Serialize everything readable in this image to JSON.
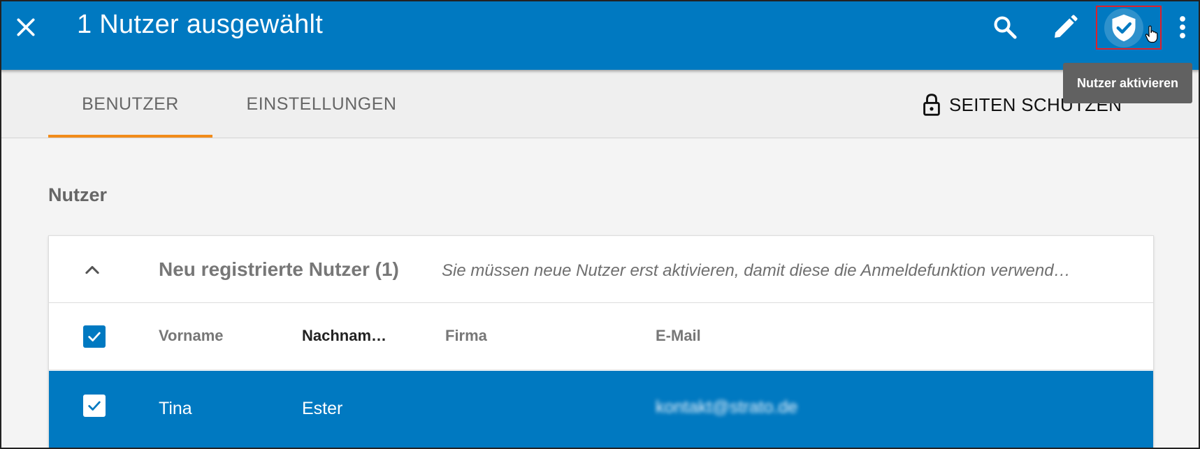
{
  "appbar": {
    "title": "1 Nutzer ausgewählt",
    "icons": {
      "close": "close-icon",
      "search": "search-icon",
      "edit": "pencil-icon",
      "activate": "shield-check-icon",
      "more": "more-vert-icon"
    },
    "colors": {
      "background": "#0079c1",
      "highlight_box": "#e0202a"
    }
  },
  "tooltip": {
    "text": "Nutzer aktivieren"
  },
  "tabs": {
    "items": [
      {
        "label": "BENUTZER",
        "active": true
      },
      {
        "label": "EINSTELLUNGEN",
        "active": false
      }
    ],
    "accent": "#f28c1a",
    "protect_label": "SEITEN SCHÜTZEN"
  },
  "content": {
    "section_title": "Nutzer",
    "group": {
      "title": "Neu registrierte Nutzer (1)",
      "hint": "Sie müssen neue Nutzer erst aktivieren, damit diese die Anmeldefunktion verwend…"
    },
    "table": {
      "columns": [
        "Vorname",
        "Nachnam…",
        "Firma",
        "E-Mail"
      ],
      "rows": [
        {
          "vorname": "Tina",
          "nachname": "Ester",
          "firma": "",
          "email": "kontakt@strato.de",
          "selected": true
        }
      ]
    }
  }
}
